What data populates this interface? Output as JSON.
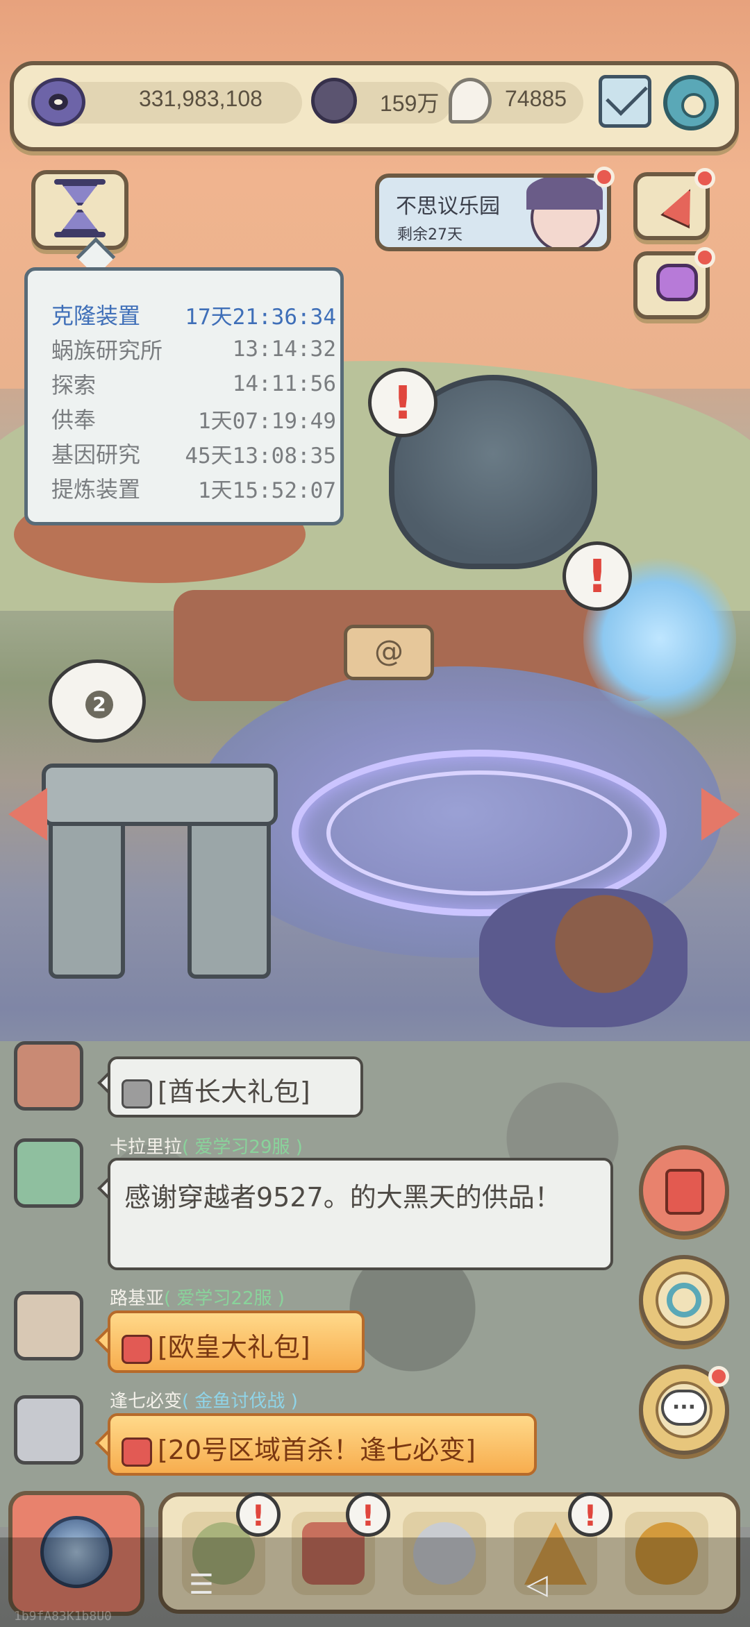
{
  "resources": {
    "eye_value": "331,983,108",
    "coin_value": "159万",
    "drop_value": "74885"
  },
  "timers": {
    "rows": [
      {
        "name": "克隆装置",
        "time": "17天21:36:34",
        "active": true
      },
      {
        "name": "蜗族研究所",
        "time": "13:14:32",
        "active": false
      },
      {
        "name": "探索",
        "time": "14:11:56",
        "active": false
      },
      {
        "name": "供奉",
        "time": "1天07:19:49",
        "active": false
      },
      {
        "name": "基因研究",
        "time": "45天13:08:35",
        "active": false
      },
      {
        "name": "提炼装置",
        "time": "1天15:52:07",
        "active": false
      }
    ]
  },
  "event": {
    "title": "不思议乐园",
    "subtitle": "剩余27天"
  },
  "scene": {
    "alert_mark": "!",
    "thought_count": "2"
  },
  "chat": {
    "messages": [
      {
        "name": "",
        "server": "",
        "text": "[酋长大礼包]",
        "type": "gray-gift"
      },
      {
        "name": "卡拉里拉",
        "server": "( 爱学习29服 )",
        "text": "感谢穿越者9527。的大黑天的供品！",
        "type": "text"
      },
      {
        "name": "路基亚",
        "server": "( 爱学习22服 )",
        "text": "[欧皇大礼包]",
        "type": "gift"
      },
      {
        "name": "逢七必变",
        "server": "( 金鱼讨伐战 )",
        "text": "[20号区域首杀！逢七必变]",
        "type": "gift"
      }
    ]
  },
  "bottom_nav": {
    "badge_mark": "!"
  },
  "system_nav": {
    "menu": "☰",
    "back": "◁"
  },
  "watermark": "1b9fA83K1b8U0"
}
